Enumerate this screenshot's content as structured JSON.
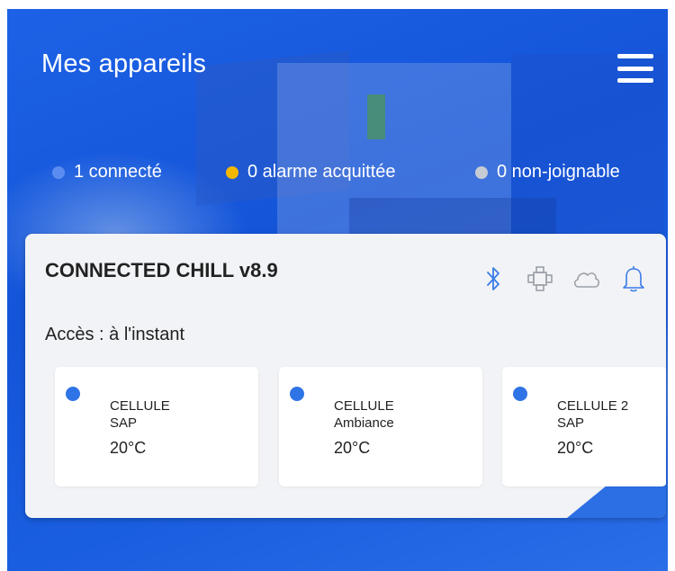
{
  "header": {
    "title": "Mes appareils"
  },
  "status": [
    {
      "label": "1 connecté",
      "color": "#5b8df0"
    },
    {
      "label": "0 alarme acquittée",
      "color": "#f5b800"
    },
    {
      "label": "0 non-joignable",
      "color": "#c7cbd3"
    }
  ],
  "device": {
    "name": "CONNECTED CHILL v8.9",
    "access": "Accès : à l'instant",
    "icons": [
      "bluetooth-icon",
      "network-icon",
      "cloud-icon",
      "bell-icon"
    ],
    "cells": [
      {
        "name": "CELLULE",
        "sub": "SAP",
        "temp": "20°C"
      },
      {
        "name": "CELLULE",
        "sub": "Ambiance",
        "temp": "20°C"
      },
      {
        "name": "CELLULE 2",
        "sub": "SAP",
        "temp": "20°C"
      }
    ]
  },
  "colors": {
    "primary": "#1a5ee0",
    "accent_dot": "#2f74e6"
  }
}
